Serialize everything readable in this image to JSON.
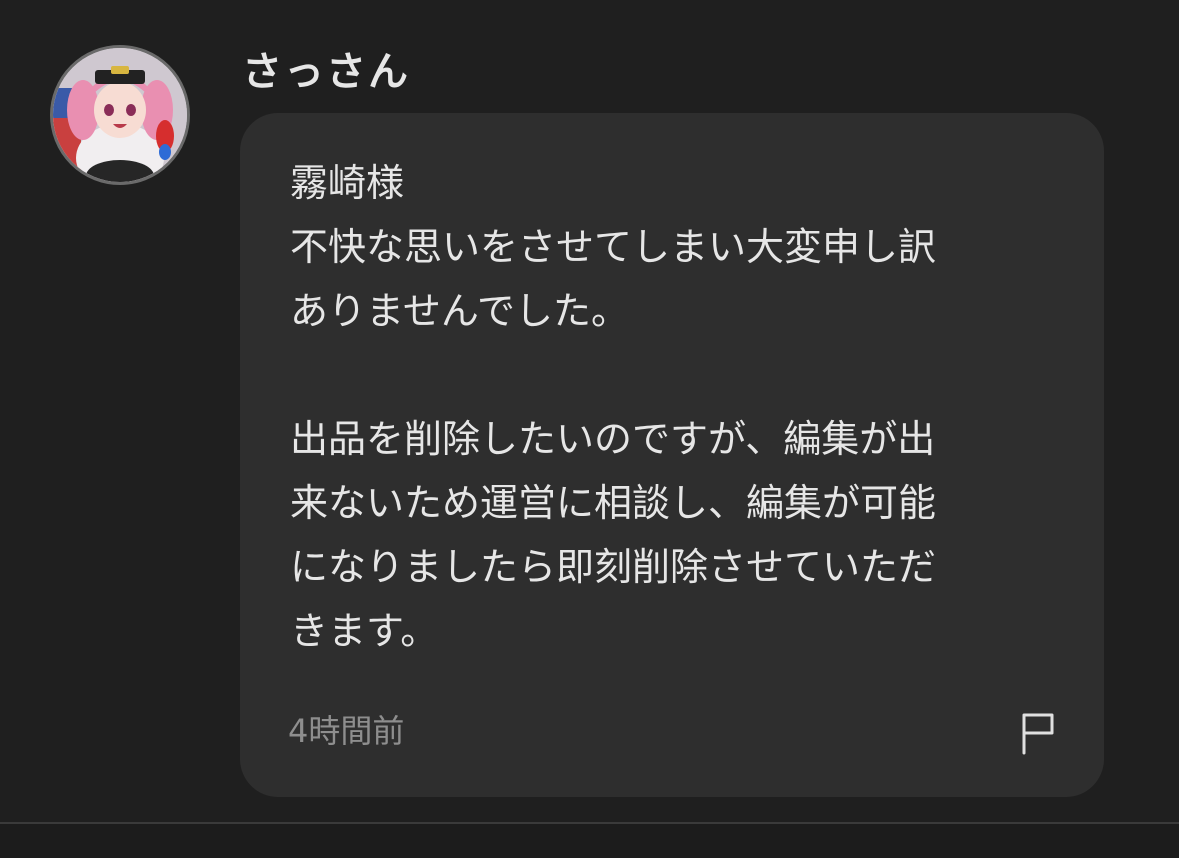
{
  "comment": {
    "author": "さっさん",
    "message_lines": [
      "霧崎様",
      "不快な思いをさせてしまい大変申し訳",
      "ありませんでした。",
      "",
      "出品を削除したいのですが、編集が出",
      "来ないため運営に相談し、編集が可能",
      "になりましたら即刻削除させていただ",
      "きます。"
    ],
    "timestamp": "4時間前",
    "avatar_icon": "user-avatar-anime-character",
    "report_icon": "flag-icon"
  },
  "colors": {
    "background": "#1f1f1f",
    "bubble": "#2e2e2e",
    "text": "#e6e6e6",
    "muted": "#8e8e8e"
  }
}
